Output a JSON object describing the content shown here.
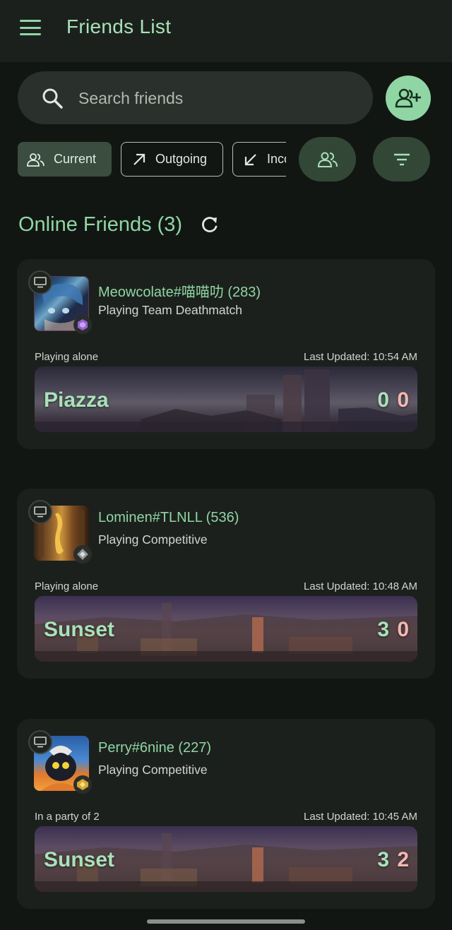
{
  "app": {
    "title": "Friends List"
  },
  "search": {
    "placeholder": "Search friends"
  },
  "filters": [
    {
      "label": "Current",
      "icon": "people-icon",
      "active": true
    },
    {
      "label": "Outgoing",
      "icon": "arrow-up-right-icon",
      "active": false
    },
    {
      "label": "Incoming",
      "icon": "arrow-down-left-icon",
      "active": false
    }
  ],
  "section": {
    "title": "Online Friends (3)"
  },
  "friends": [
    {
      "name": "Meowcolate#喵喵叻 (283)",
      "status": "Playing Team Deathmatch",
      "party": "Playing alone",
      "last_updated": "Last Updated: 10:54 AM",
      "map": "Piazza",
      "score_ally": "0",
      "score_enemy": "0"
    },
    {
      "name": "Lominen#TLNLL (536)",
      "status": "Playing Competitive",
      "party": "Playing alone",
      "last_updated": "Last Updated: 10:48 AM",
      "map": "Sunset",
      "score_ally": "3",
      "score_enemy": "0"
    },
    {
      "name": "Perry#6nine (227)",
      "status": "Playing Competitive",
      "party": "In a party of 2",
      "last_updated": "Last Updated: 10:45 AM",
      "map": "Sunset",
      "score_ally": "3",
      "score_enemy": "2"
    }
  ],
  "colors": {
    "accent": "#8fd6a4",
    "background": "#121613",
    "card": "#1c201d",
    "enemy_score": "#f2b8b0"
  }
}
